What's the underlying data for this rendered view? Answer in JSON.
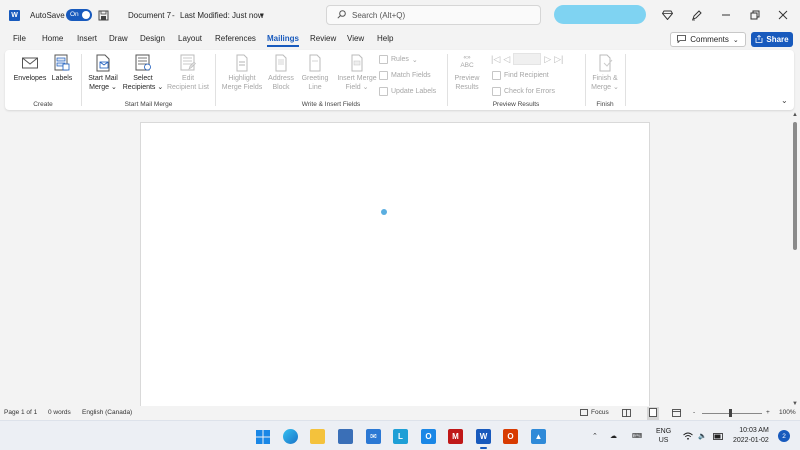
{
  "titlebar": {
    "autosave_label": "AutoSave",
    "autosave_state": "On",
    "document_title": "Document 7",
    "modified_status": "Last Modified: Just now",
    "search_placeholder": "Search (Alt+Q)",
    "icons": [
      "word-logo-icon",
      "save-icon",
      "search-icon",
      "diamond-icon",
      "pen-icon",
      "minimize-icon",
      "restore-icon",
      "close-icon"
    ]
  },
  "menu": {
    "tabs": [
      "File",
      "Home",
      "Insert",
      "Draw",
      "Design",
      "Layout",
      "References",
      "Mailings",
      "Review",
      "View",
      "Help"
    ],
    "active_tab": "Mailings",
    "comments_label": "Comments",
    "share_label": "Share"
  },
  "ribbon": {
    "create": {
      "label": "Create",
      "envelopes": "Envelopes",
      "labels": "Labels"
    },
    "start_mail_merge": {
      "label": "Start Mail Merge",
      "start_line1": "Start Mail",
      "start_line2": "Merge",
      "select_line1": "Select",
      "select_line2": "Recipients",
      "edit_line1": "Edit",
      "edit_line2": "Recipient List"
    },
    "write_insert": {
      "label": "Write & Insert Fields",
      "highlight_line1": "Highlight",
      "highlight_line2": "Merge Fields",
      "address_line1": "Address",
      "address_line2": "Block",
      "greeting_line1": "Greeting",
      "greeting_line2": "Line",
      "insert_line1": "Insert Merge",
      "insert_line2": "Field",
      "rules": "Rules",
      "match_fields": "Match Fields",
      "update_labels": "Update Labels"
    },
    "preview": {
      "label": "Preview Results",
      "abc": "ABC",
      "preview_line1": "Preview",
      "preview_line2": "Results",
      "find_recipient": "Find Recipient",
      "check_errors": "Check for Errors"
    },
    "finish": {
      "label": "Finish",
      "finish_line1": "Finish &",
      "finish_line2": "Merge"
    }
  },
  "statusbar": {
    "page": "Page 1 of 1",
    "words": "0 words",
    "language": "English (Canada)",
    "focus": "Focus",
    "zoom": "100%",
    "zoom_minus": "-",
    "zoom_plus": "+"
  },
  "taskbar": {
    "language_line1": "ENG",
    "language_line2": "US",
    "time": "10:03 AM",
    "date": "2022-01-02",
    "notification_count": "2"
  },
  "colors": {
    "accent": "#185abd",
    "account_blob": "#7fd3f2"
  }
}
